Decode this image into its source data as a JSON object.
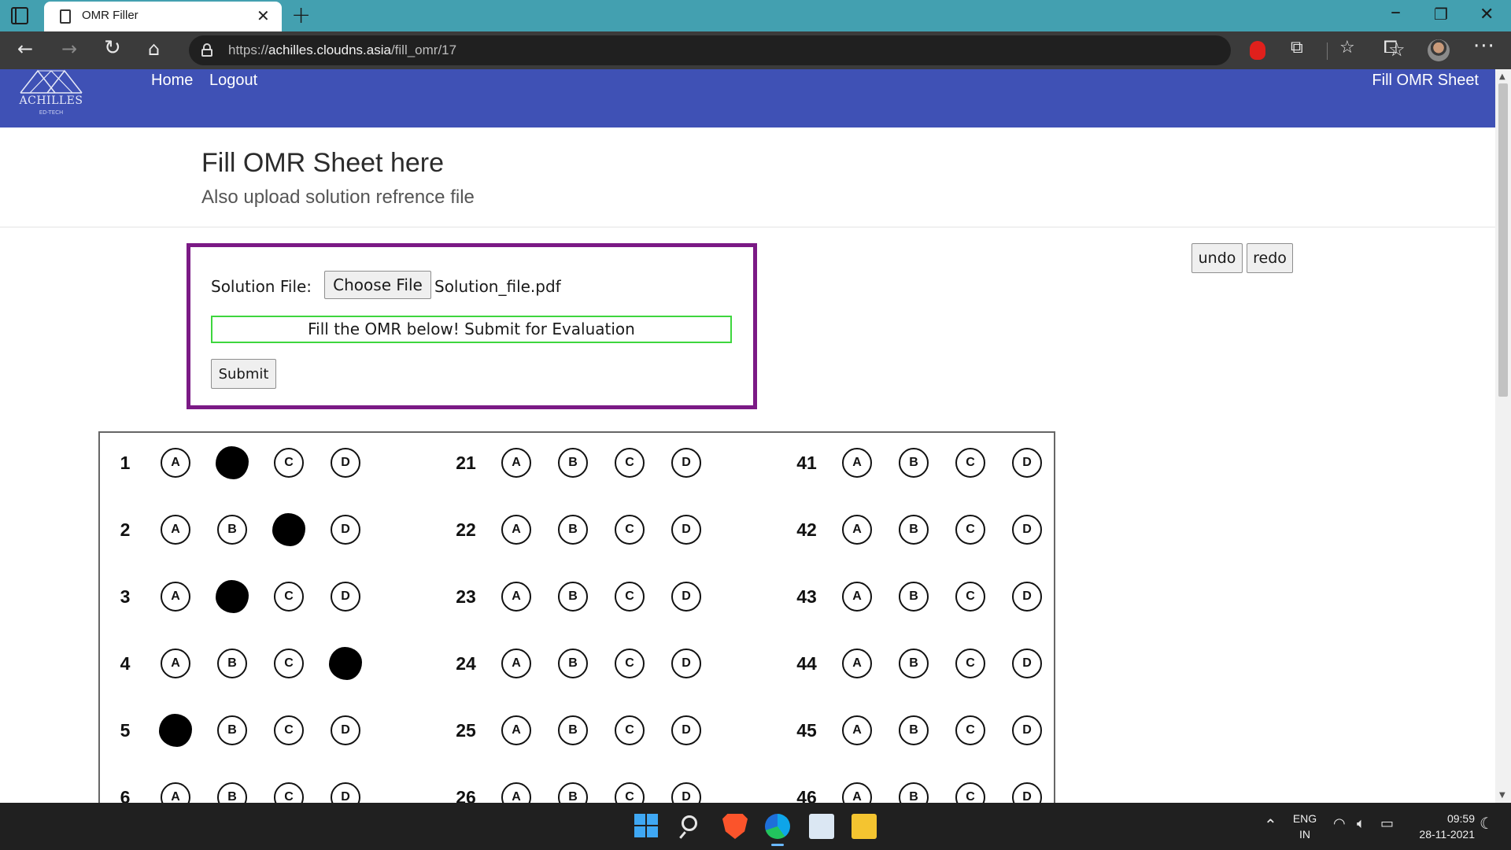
{
  "browser": {
    "tab_title": "OMR Filler",
    "url_scheme": "https://",
    "url_host": "achilles.cloudns.asia",
    "url_path": "/fill_omr/17"
  },
  "site": {
    "logo_name": "ACHILLES",
    "logo_sub": "ED-TECH",
    "nav_home": "Home",
    "nav_logout": "Logout",
    "nav_right": "Fill OMR Sheet",
    "title": "Fill OMR Sheet here",
    "subtitle": "Also upload solution refrence file",
    "solution_label": "Solution File:",
    "choose_file_label": "Choose File",
    "file_name": "Solution_file.pdf",
    "omr_message": "Fill the OMR below! Submit for Evaluation",
    "submit_label": "Submit",
    "undo_label": "undo",
    "redo_label": "redo",
    "brand_color": "#3f51b5",
    "form_border_color": "#7b1a85",
    "message_border_color": "#3ed63e"
  },
  "omr": {
    "options": [
      "A",
      "B",
      "C",
      "D"
    ],
    "columns": [
      {
        "questions": [
          {
            "number": "1",
            "filled": "B"
          },
          {
            "number": "2",
            "filled": "C"
          },
          {
            "number": "3",
            "filled": "B"
          },
          {
            "number": "4",
            "filled": "D"
          },
          {
            "number": "5",
            "filled": "A"
          },
          {
            "number": "6",
            "filled": ""
          }
        ]
      },
      {
        "questions": [
          {
            "number": "21",
            "filled": ""
          },
          {
            "number": "22",
            "filled": ""
          },
          {
            "number": "23",
            "filled": ""
          },
          {
            "number": "24",
            "filled": ""
          },
          {
            "number": "25",
            "filled": ""
          },
          {
            "number": "26",
            "filled": ""
          }
        ]
      },
      {
        "questions": [
          {
            "number": "41",
            "filled": ""
          },
          {
            "number": "42",
            "filled": ""
          },
          {
            "number": "43",
            "filled": ""
          },
          {
            "number": "44",
            "filled": ""
          },
          {
            "number": "45",
            "filled": ""
          },
          {
            "number": "46",
            "filled": ""
          }
        ]
      }
    ]
  },
  "taskbar": {
    "lang_line1": "ENG",
    "lang_line2": "IN",
    "time": "09:59",
    "date": "28-11-2021"
  }
}
